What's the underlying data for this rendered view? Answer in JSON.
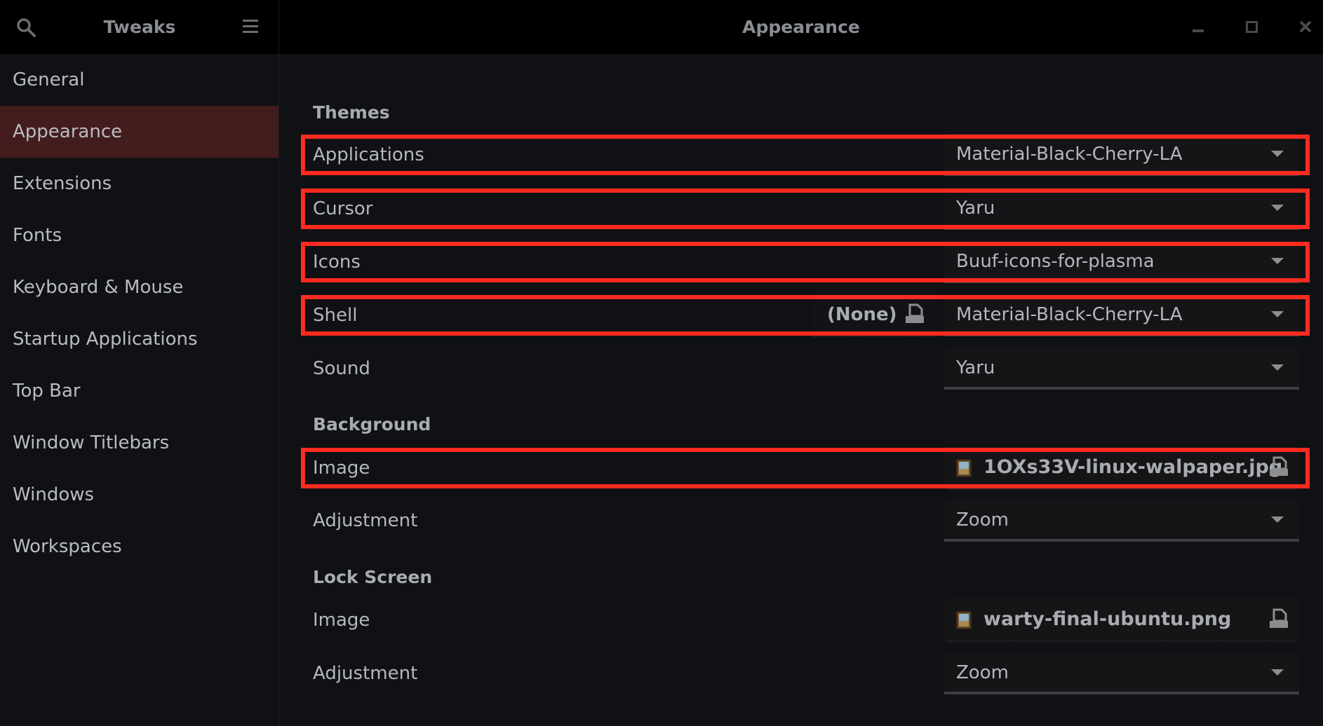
{
  "window": {
    "app_title": "Tweaks",
    "page_title": "Appearance",
    "controls": {
      "minimize": "minimize",
      "maximize": "maximize",
      "close": "×"
    }
  },
  "sidebar": {
    "items": [
      {
        "label": "General",
        "active": false
      },
      {
        "label": "Appearance",
        "active": true
      },
      {
        "label": "Extensions",
        "active": false
      },
      {
        "label": "Fonts",
        "active": false
      },
      {
        "label": "Keyboard & Mouse",
        "active": false
      },
      {
        "label": "Startup Applications",
        "active": false
      },
      {
        "label": "Top Bar",
        "active": false
      },
      {
        "label": "Window Titlebars",
        "active": false
      },
      {
        "label": "Windows",
        "active": false
      },
      {
        "label": "Workspaces",
        "active": false
      }
    ]
  },
  "main": {
    "themes": {
      "heading": "Themes",
      "applications": {
        "label": "Applications",
        "value": "Material-Black-Cherry-LA"
      },
      "cursor": {
        "label": "Cursor",
        "value": "Yaru"
      },
      "icons": {
        "label": "Icons",
        "value": "Buuf-icons-for-plasma"
      },
      "shell": {
        "label": "Shell",
        "none_label": "(None)",
        "value": "Material-Black-Cherry-LA"
      },
      "sound": {
        "label": "Sound",
        "value": "Yaru"
      }
    },
    "background": {
      "heading": "Background",
      "image": {
        "label": "Image",
        "value": "1OXs33V-linux-walpaper.jpg"
      },
      "adjustment": {
        "label": "Adjustment",
        "value": "Zoom"
      }
    },
    "lock_screen": {
      "heading": "Lock Screen",
      "image": {
        "label": "Image",
        "value": "warty-final-ubuntu.png"
      },
      "adjustment": {
        "label": "Adjustment",
        "value": "Zoom"
      }
    }
  },
  "annotations": {
    "highlight_color": "#ff2a20"
  },
  "colors": {
    "selected_sidebar": "#431c1e",
    "background": "#101114",
    "titlebar": "#000000"
  }
}
